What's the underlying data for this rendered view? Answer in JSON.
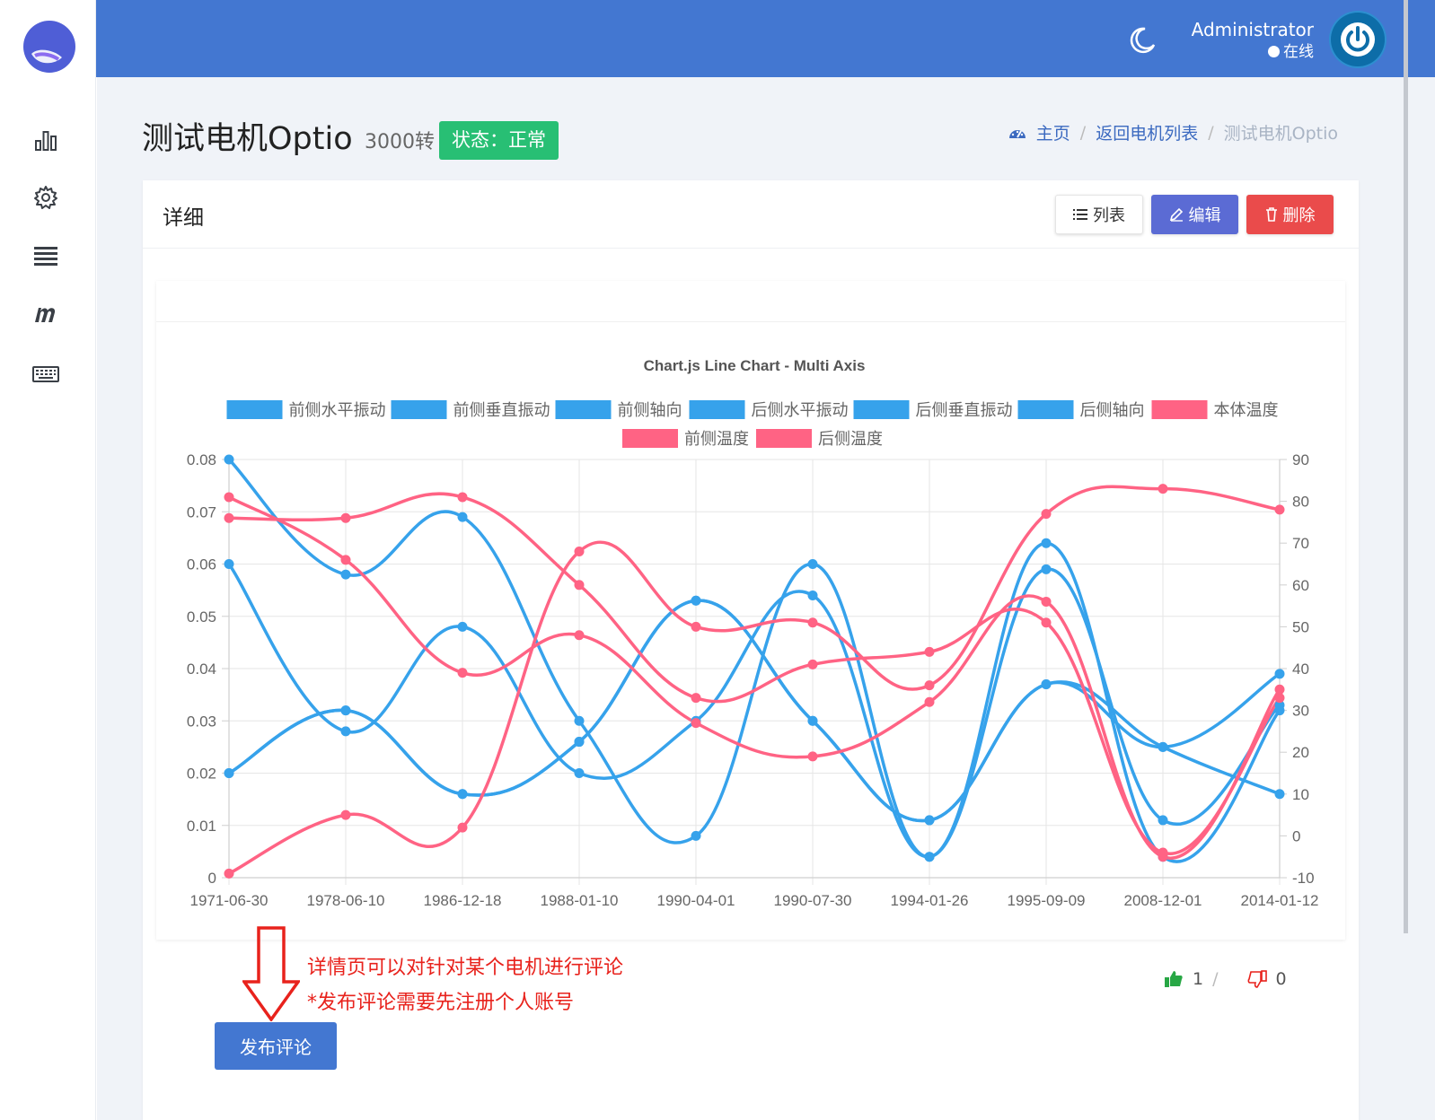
{
  "topbar": {
    "user_name": "Administrator",
    "user_status": "在线"
  },
  "page": {
    "title": "测试电机Optio",
    "rpm": "3000转",
    "status": "状态：正常"
  },
  "breadcrumb": {
    "home": "主页",
    "sep1": "/",
    "back": "返回电机列表",
    "sep2": "/",
    "current": "测试电机Optio"
  },
  "card": {
    "title": "详细",
    "btn_list": "列表",
    "btn_edit": "编辑",
    "btn_delete": "删除"
  },
  "annotation": {
    "line1": "详情页可以对针对某个电机进行评论",
    "line2": "*发布评论需要先注册个人账号"
  },
  "comment_button": "发布评论",
  "votes": {
    "up": "1",
    "sep": "/",
    "down": "0"
  },
  "colors": {
    "blue": "#36a2eb",
    "pink": "#ff6384",
    "topbar": "#4377d1",
    "badge": "#28bf74"
  },
  "chart_data": {
    "type": "line",
    "title": "Chart.js Line Chart - Multi Axis",
    "categories": [
      "1971-06-30",
      "1978-06-10",
      "1986-12-18",
      "1988-01-10",
      "1990-04-01",
      "1990-07-30",
      "1994-01-26",
      "1995-09-09",
      "2008-12-01",
      "2014-01-12"
    ],
    "y_left": {
      "min": 0,
      "max": 0.08,
      "ticks": [
        "0",
        "0.01",
        "0.02",
        "0.03",
        "0.04",
        "0.05",
        "0.06",
        "0.07",
        "0.08"
      ]
    },
    "y_right": {
      "min": -10,
      "max": 90,
      "ticks": [
        "-10",
        "0",
        "10",
        "20",
        "30",
        "40",
        "50",
        "60",
        "70",
        "80",
        "90"
      ]
    },
    "legend_position": "top",
    "grid": true,
    "series": [
      {
        "name": "前侧水平振动",
        "axis": "left",
        "color": "#36a2eb",
        "values": [
          0.08,
          0.058,
          0.069,
          0.03,
          0.008,
          0.06,
          0.004,
          0.064,
          0.004,
          0.032
        ]
      },
      {
        "name": "前侧垂直振动",
        "axis": "left",
        "color": "#36a2eb",
        "values": [
          0.06,
          0.028,
          0.048,
          0.02,
          0.03,
          0.054,
          0.004,
          0.059,
          0.011,
          0.033
        ]
      },
      {
        "name": "前侧轴向",
        "axis": "left",
        "color": "#36a2eb",
        "values": [
          0.02,
          0.032,
          0.016,
          0.026,
          0.053,
          0.03,
          0.011,
          0.037,
          0.025,
          0.016
        ]
      },
      {
        "name": "后侧水平振动",
        "axis": "left",
        "color": "#36a2eb",
        "values": []
      },
      {
        "name": "后侧垂直振动",
        "axis": "left",
        "color": "#36a2eb",
        "values": []
      },
      {
        "name": "后侧轴向",
        "axis": "left",
        "color": "#36a2eb",
        "values": [
          0.02,
          0.032,
          0.016,
          0.026,
          0.053,
          0.03,
          0.011,
          0.037,
          0.025,
          0.039
        ]
      },
      {
        "name": "本体温度",
        "axis": "right",
        "color": "#ff6384",
        "values": [
          -9,
          5,
          2,
          68,
          50,
          51,
          36,
          77,
          83,
          78
        ]
      },
      {
        "name": "前侧温度",
        "axis": "right",
        "color": "#ff6384",
        "values": [
          81,
          66,
          39,
          48,
          27,
          19,
          32,
          56,
          -5,
          35
        ]
      },
      {
        "name": "后侧温度",
        "axis": "right",
        "color": "#ff6384",
        "values": [
          76,
          76,
          81,
          60,
          33,
          41,
          44,
          51,
          -4,
          33
        ]
      }
    ]
  }
}
